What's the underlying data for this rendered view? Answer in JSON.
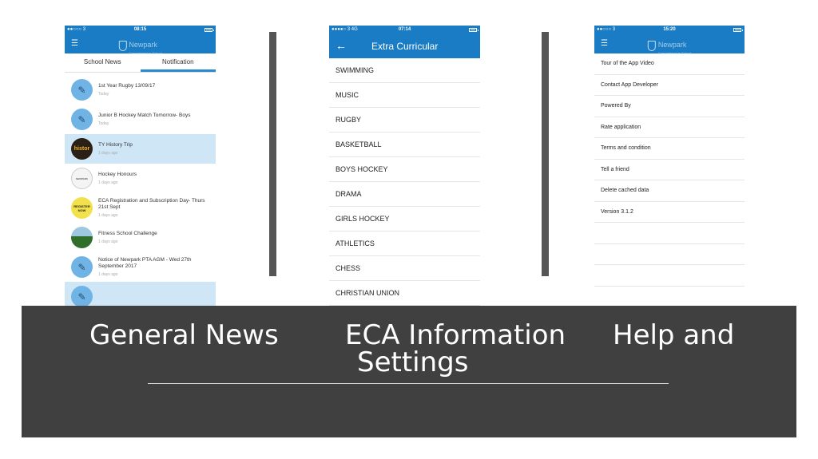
{
  "phone1": {
    "status": {
      "signal": "●●○○○ 3 ",
      "time": "08:15"
    },
    "logo": {
      "title": "Newpark",
      "subtitle": "Comprehensive School"
    },
    "tabs": [
      {
        "label": "School News"
      },
      {
        "label": "Notification"
      }
    ],
    "news": [
      {
        "title": "1st Year Rugby 13/09/17",
        "date": "Today",
        "icon": "pen-icon"
      },
      {
        "title": "Junior B Hockey Match Tomorrow- Boys",
        "date": "Today",
        "icon": "pen-icon"
      },
      {
        "title": "TY History Trip",
        "date": "1 days ago",
        "icon": "history-thumbnail",
        "thumb_text": "histor"
      },
      {
        "title": "Hockey Honours",
        "date": "1 days ago",
        "icon": "hockey-thumbnail",
        "thumb_text": "NEWPARK"
      },
      {
        "title": "ECA Registration and Subscription Day- Thurs 21st Sept",
        "date": "1 days ago",
        "icon": "register-thumbnail",
        "thumb_text": "REGISTER NOW"
      },
      {
        "title": "Fitness School Challenge",
        "date": "1 days ago",
        "icon": "field-thumbnail"
      },
      {
        "title": "Notice of Newpark PTA AGM - Wed 27th September 2017",
        "date": "1 days ago",
        "icon": "pen-icon"
      }
    ]
  },
  "phone2": {
    "status": {
      "signal": "●●●●○ 3  4G",
      "time": "07:14"
    },
    "title": "Extra Curricular",
    "items": [
      {
        "label": "SWIMMING"
      },
      {
        "label": "MUSIC"
      },
      {
        "label": "RUGBY"
      },
      {
        "label": "BASKETBALL"
      },
      {
        "label": "BOYS HOCKEY"
      },
      {
        "label": "DRAMA"
      },
      {
        "label": "GIRLS HOCKEY"
      },
      {
        "label": "ATHLETICS"
      },
      {
        "label": "CHESS"
      },
      {
        "label": "CHRISTIAN UNION"
      }
    ]
  },
  "phone3": {
    "status": {
      "signal": "●●○○○ 3 ",
      "time": "15:20"
    },
    "logo": {
      "title": "Newpark",
      "subtitle": "Comprehensive School"
    },
    "items": [
      {
        "label": "Tour of the App Video"
      },
      {
        "label": "Contact App Developer"
      },
      {
        "label": "Powered By"
      },
      {
        "label": "Rate application"
      },
      {
        "label": "Terms and condition"
      },
      {
        "label": "Tell a friend"
      },
      {
        "label": "Delete cached data"
      },
      {
        "label": "Version 3.1.2"
      }
    ]
  },
  "captions": {
    "general": "General News",
    "eca": "ECA Information",
    "help": "Help and",
    "settings": "Settings"
  },
  "colors": {
    "nav_blue": "#1a7cc4",
    "highlight": "#cfe6f7",
    "banner": "#404040"
  }
}
